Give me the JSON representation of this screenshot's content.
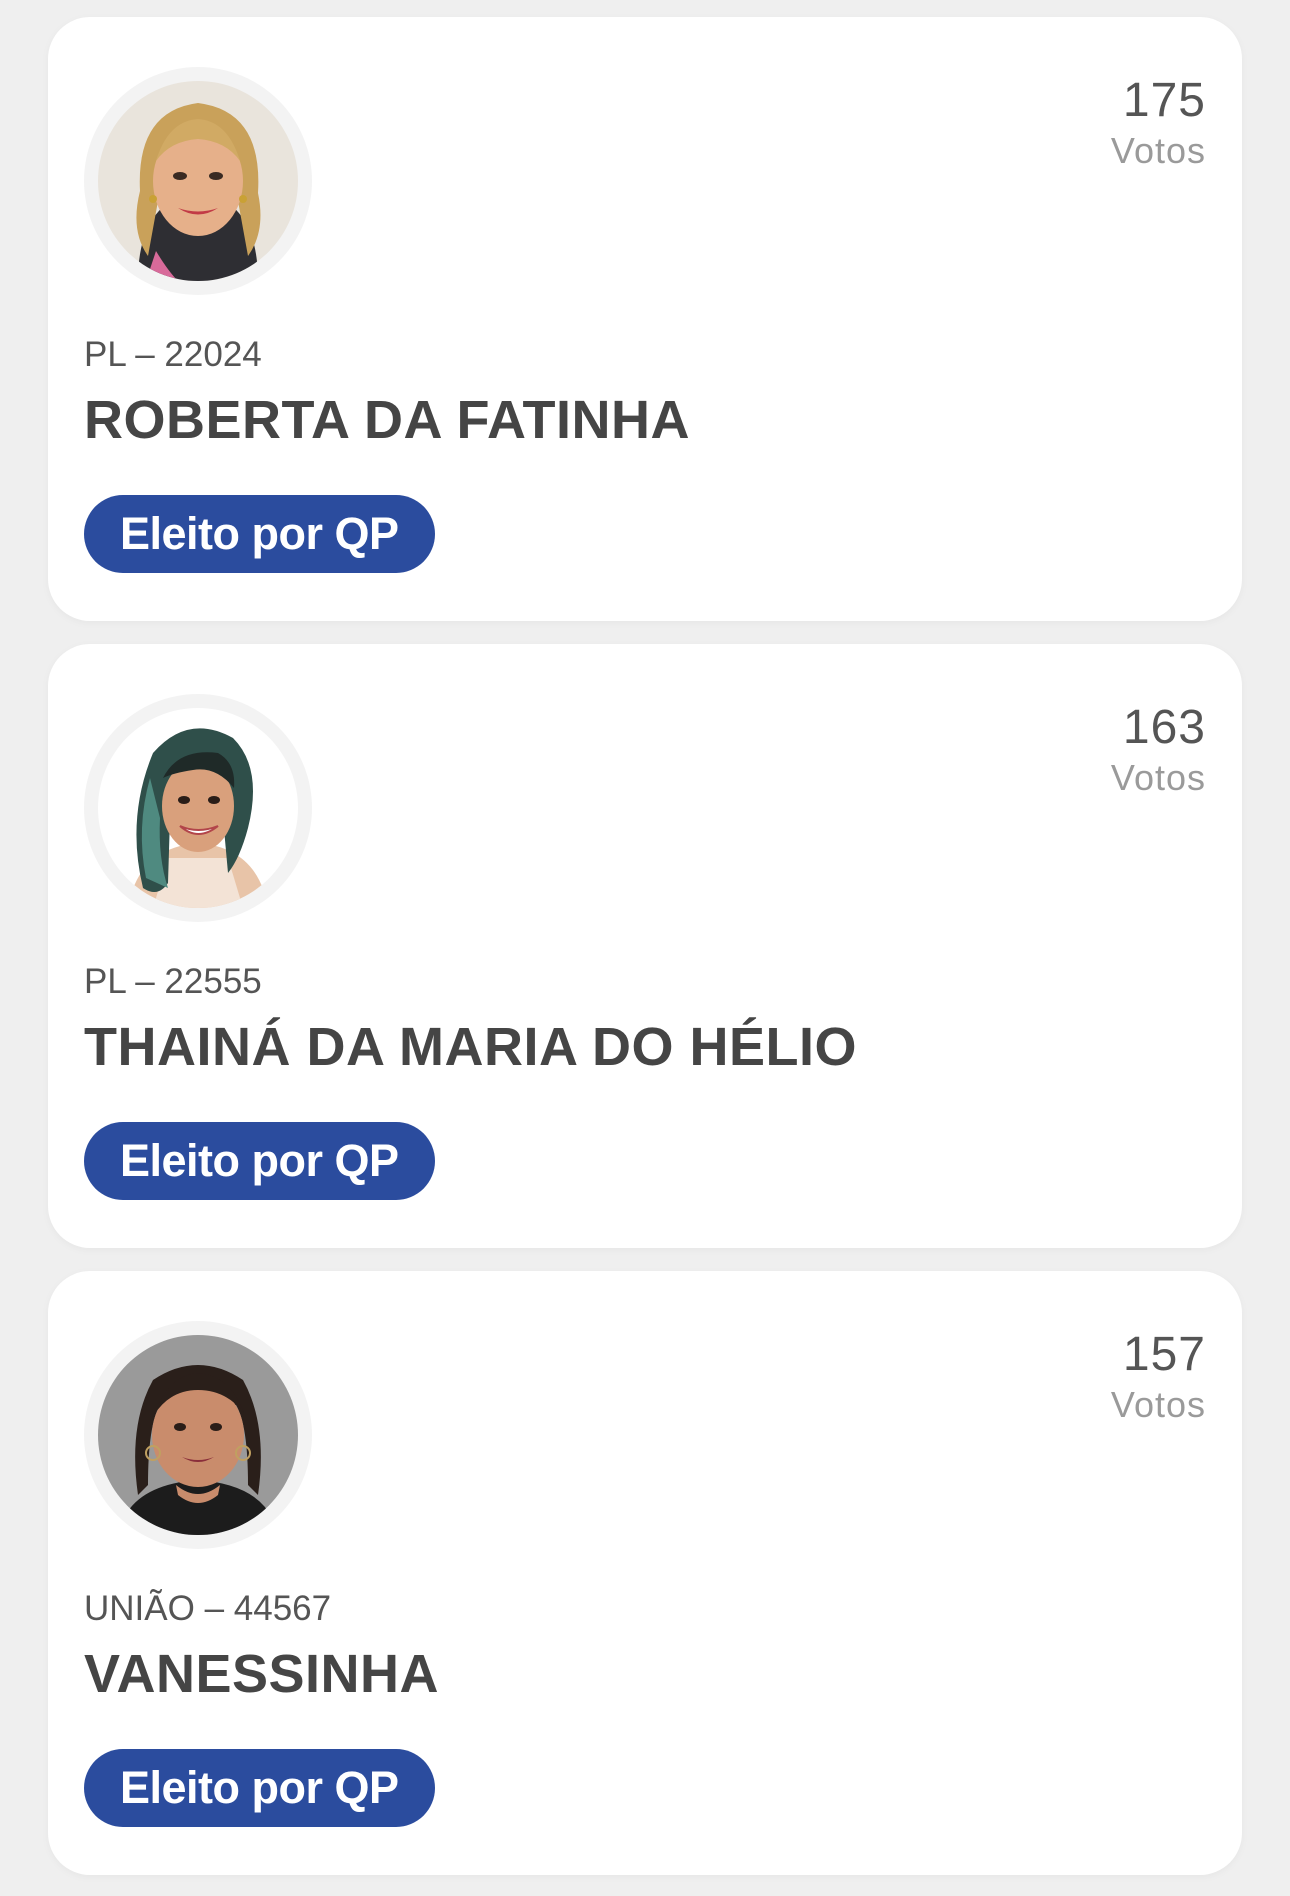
{
  "candidates": [
    {
      "party_number": "PL – 22024",
      "name": "ROBERTA DA FATINHA",
      "votes": "175",
      "votes_label": "Votos",
      "status": "Eleito por QP"
    },
    {
      "party_number": "PL – 22555",
      "name": "THAINÁ DA MARIA DO HÉLIO",
      "votes": "163",
      "votes_label": "Votos",
      "status": "Eleito por QP"
    },
    {
      "party_number": "UNIÃO – 44567",
      "name": "VANESSINHA",
      "votes": "157",
      "votes_label": "Votos",
      "status": "Eleito por QP"
    }
  ],
  "colors": {
    "badge": "#2b4c9e",
    "background": "#efefef",
    "card": "#ffffff"
  }
}
